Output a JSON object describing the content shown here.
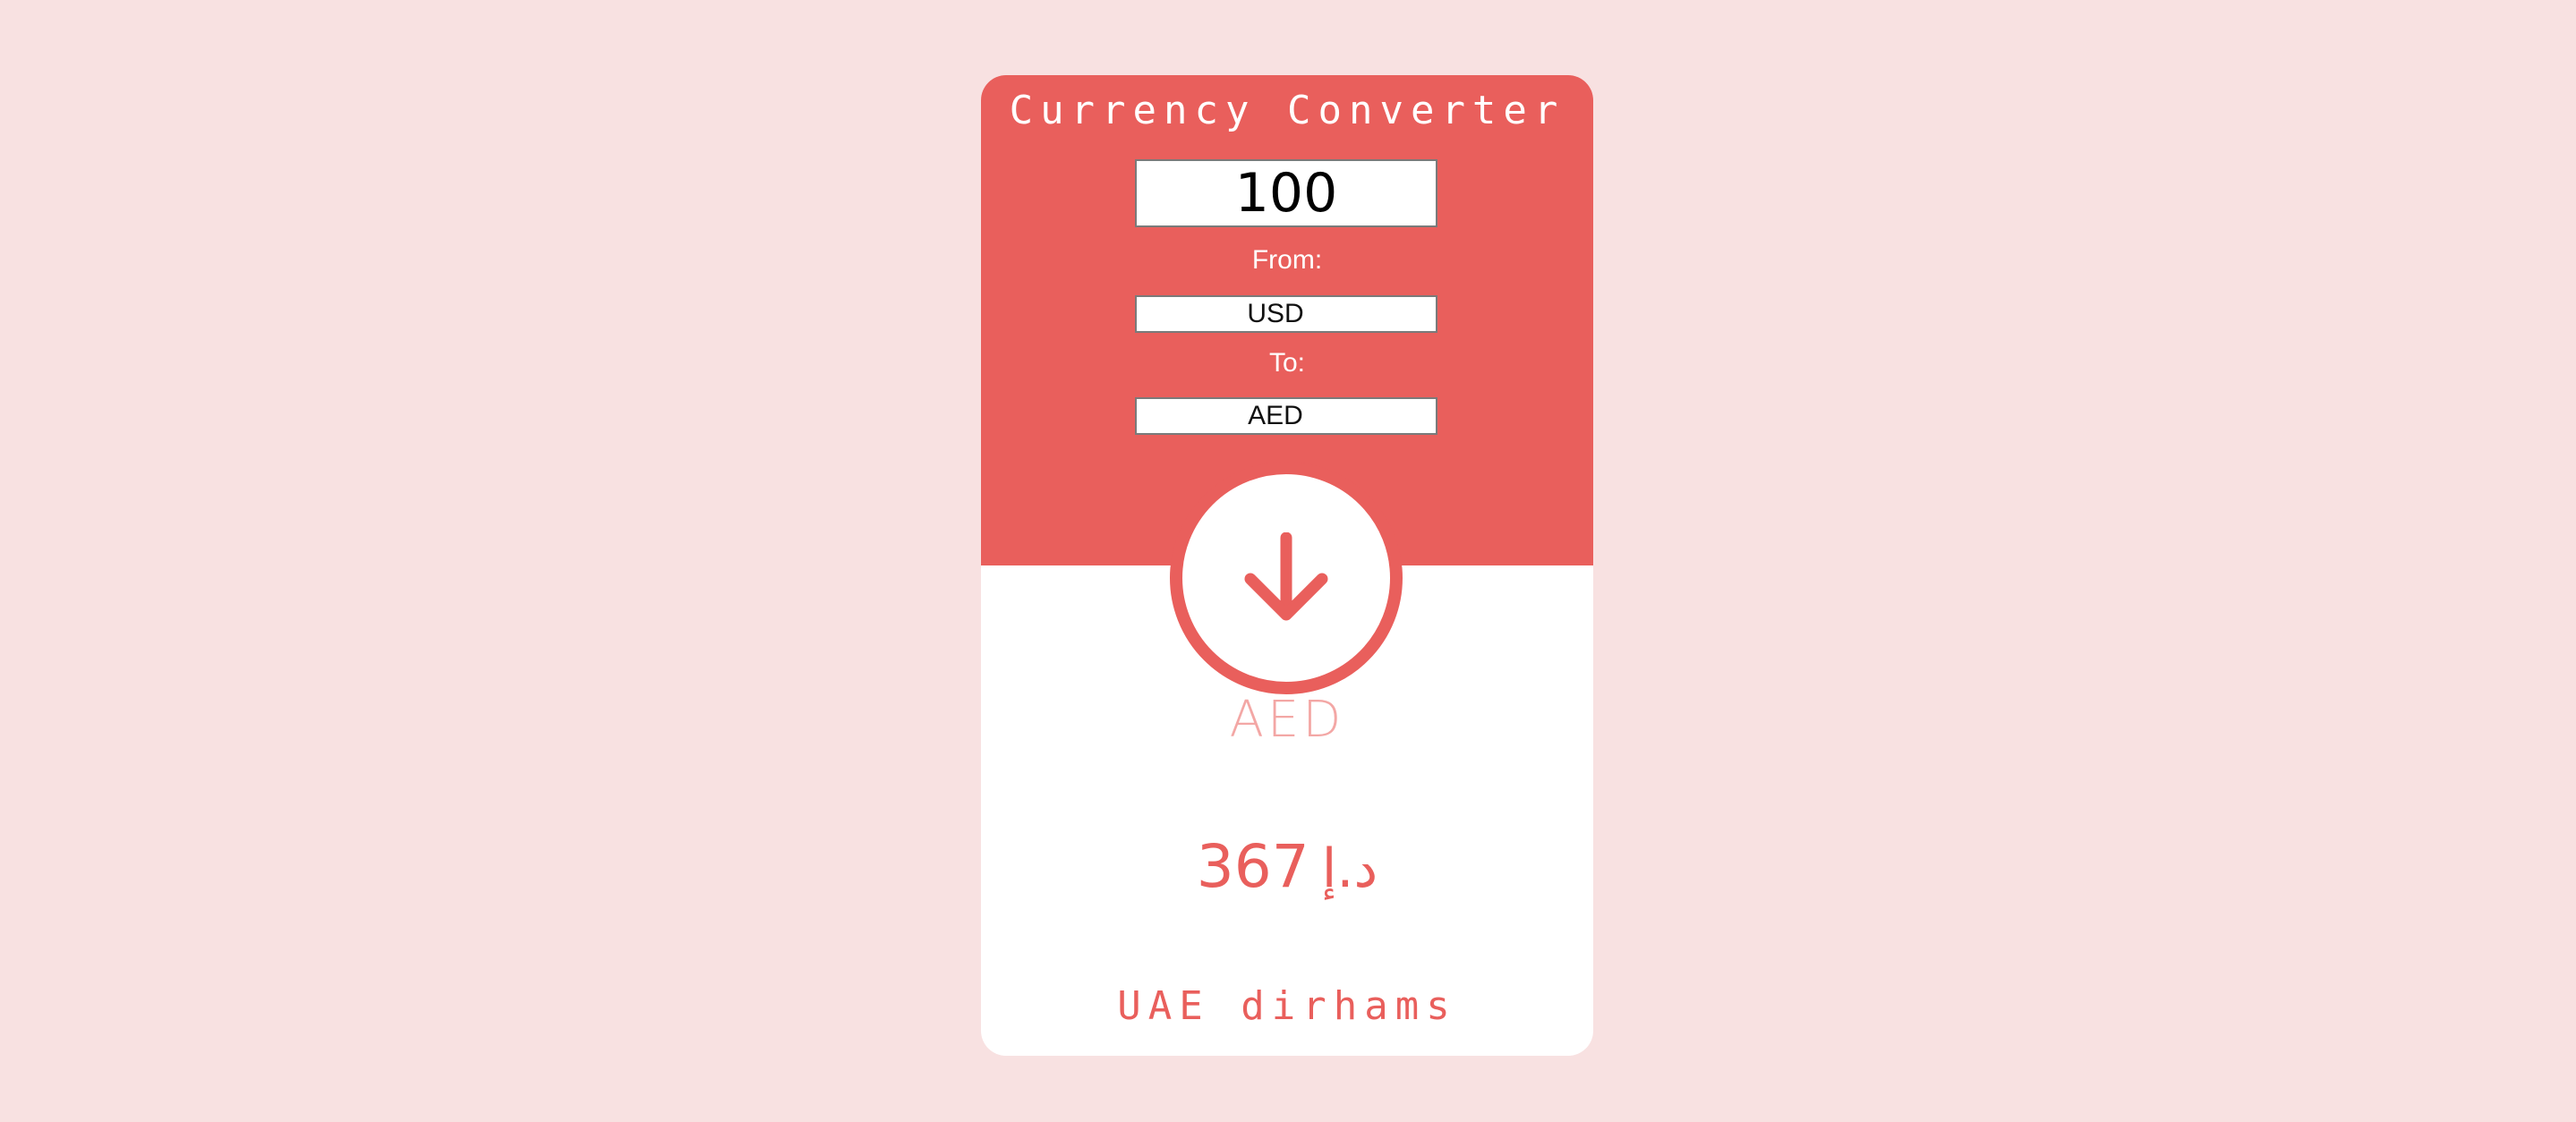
{
  "app": {
    "title": "Currency Converter"
  },
  "form": {
    "amount": "100",
    "from_label": "From:",
    "from_currency": "USD",
    "to_label": "To:",
    "to_currency": "AED"
  },
  "result": {
    "currency_code": "AED",
    "amount": "367",
    "symbol": "د.إ",
    "currency_name": "UAE dirhams"
  },
  "icons": {
    "convert": "arrow-down-icon"
  },
  "colors": {
    "page_background": "#f8e1e1",
    "accent": "#e95f5c",
    "accent_light": "#f3a7a5",
    "card_background": "#ffffff"
  }
}
